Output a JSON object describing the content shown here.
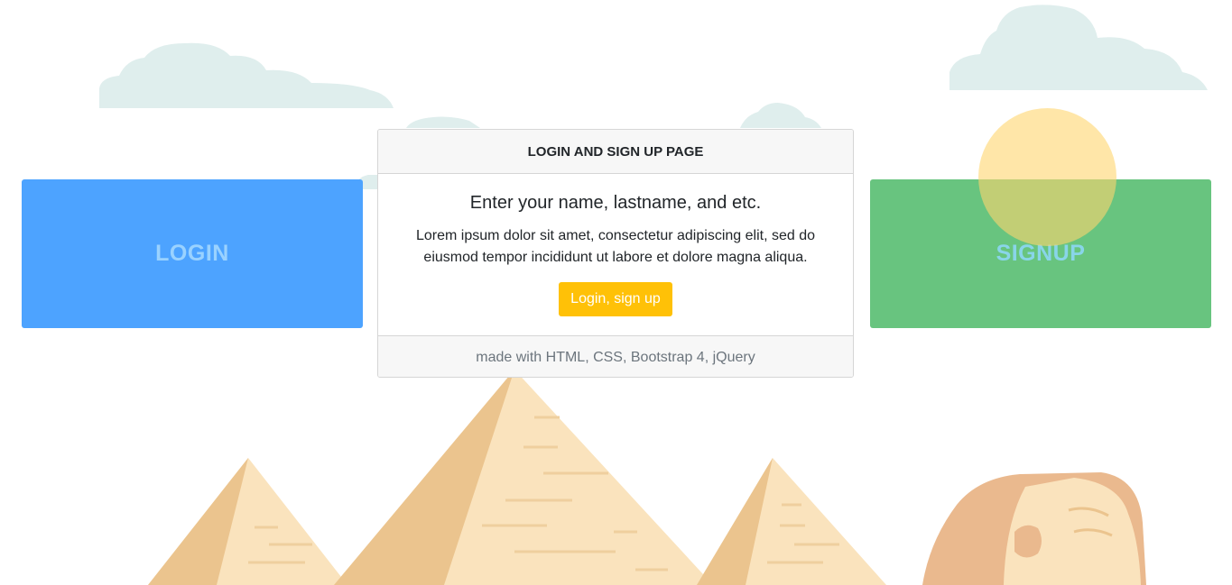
{
  "panels": {
    "login_label": "LOGIN",
    "signup_label": "SIGNUP"
  },
  "card": {
    "header": "LOGIN AND SIGN UP PAGE",
    "title": "Enter your name, lastname, and etc.",
    "text": "Lorem ipsum dolor sit amet, consectetur adipiscing elit, sed do eiusmod tempor incididunt ut labore et dolore magna aliqua.",
    "button_label": "Login, sign up",
    "footer": "made with HTML, CSS, Bootstrap 4, jQuery"
  },
  "colors": {
    "login_panel": "#4da3ff",
    "signup_panel": "#68c47f",
    "button": "#ffc107",
    "cloud": "#dfeeed",
    "sand_light": "#fae3bd",
    "sand_dark": "#ebc48e",
    "sphinx": "#eab98e",
    "sun": "#ffe19a"
  },
  "scenery_icons": [
    "cloud-icon",
    "sun-icon",
    "pyramid-icon",
    "sphinx-icon"
  ]
}
